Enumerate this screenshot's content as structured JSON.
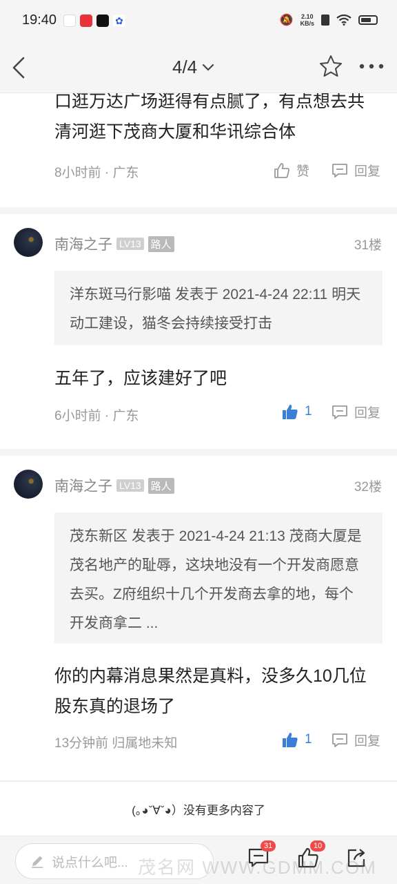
{
  "status": {
    "time": "19:40",
    "speed_top": "2.10",
    "speed_bottom": "KB/s"
  },
  "nav": {
    "pager": "4/4"
  },
  "prev_post": {
    "text": "口逛万达广场逛得有点腻了，有点想去共清河逛下茂商大厦和华讯综合体",
    "time_loc": "8小时前 · 广东",
    "like_label": "赞",
    "reply_label": "回复"
  },
  "posts": [
    {
      "author": "南海之子",
      "level": "LV13",
      "role": "路人",
      "floor": "31楼",
      "quote": "洋东斑马行影喵 发表于 2021-4-24 22:11 明天动工建设，猫冬会持续接受打击",
      "body": "五年了，应该建好了吧",
      "time_loc": "6小时前 · 广东",
      "likes": "1",
      "reply_label": "回复"
    },
    {
      "author": "南海之子",
      "level": "LV13",
      "role": "路人",
      "floor": "32楼",
      "quote": "茂东新区 发表于 2021-4-24 21:13 茂商大厦是茂名地产的耻辱，这块地没有一个开发商愿意去买。Z府组织十几个开发商去拿的地，每个开发商拿二 ...",
      "body": "你的内幕消息果然是真料，没多久10几位股东真的退场了",
      "time_loc": "13分钟前 归属地未知",
      "likes": "1",
      "reply_label": "回复"
    }
  ],
  "end_note": "(｡◕ˇ∀ˇ◕）没有更多内容了",
  "bottom": {
    "input_placeholder": "说点什么吧...",
    "comment_count": "31",
    "like_count": "10",
    "watermark": "茂名网 WWW.GDMM.COM"
  }
}
